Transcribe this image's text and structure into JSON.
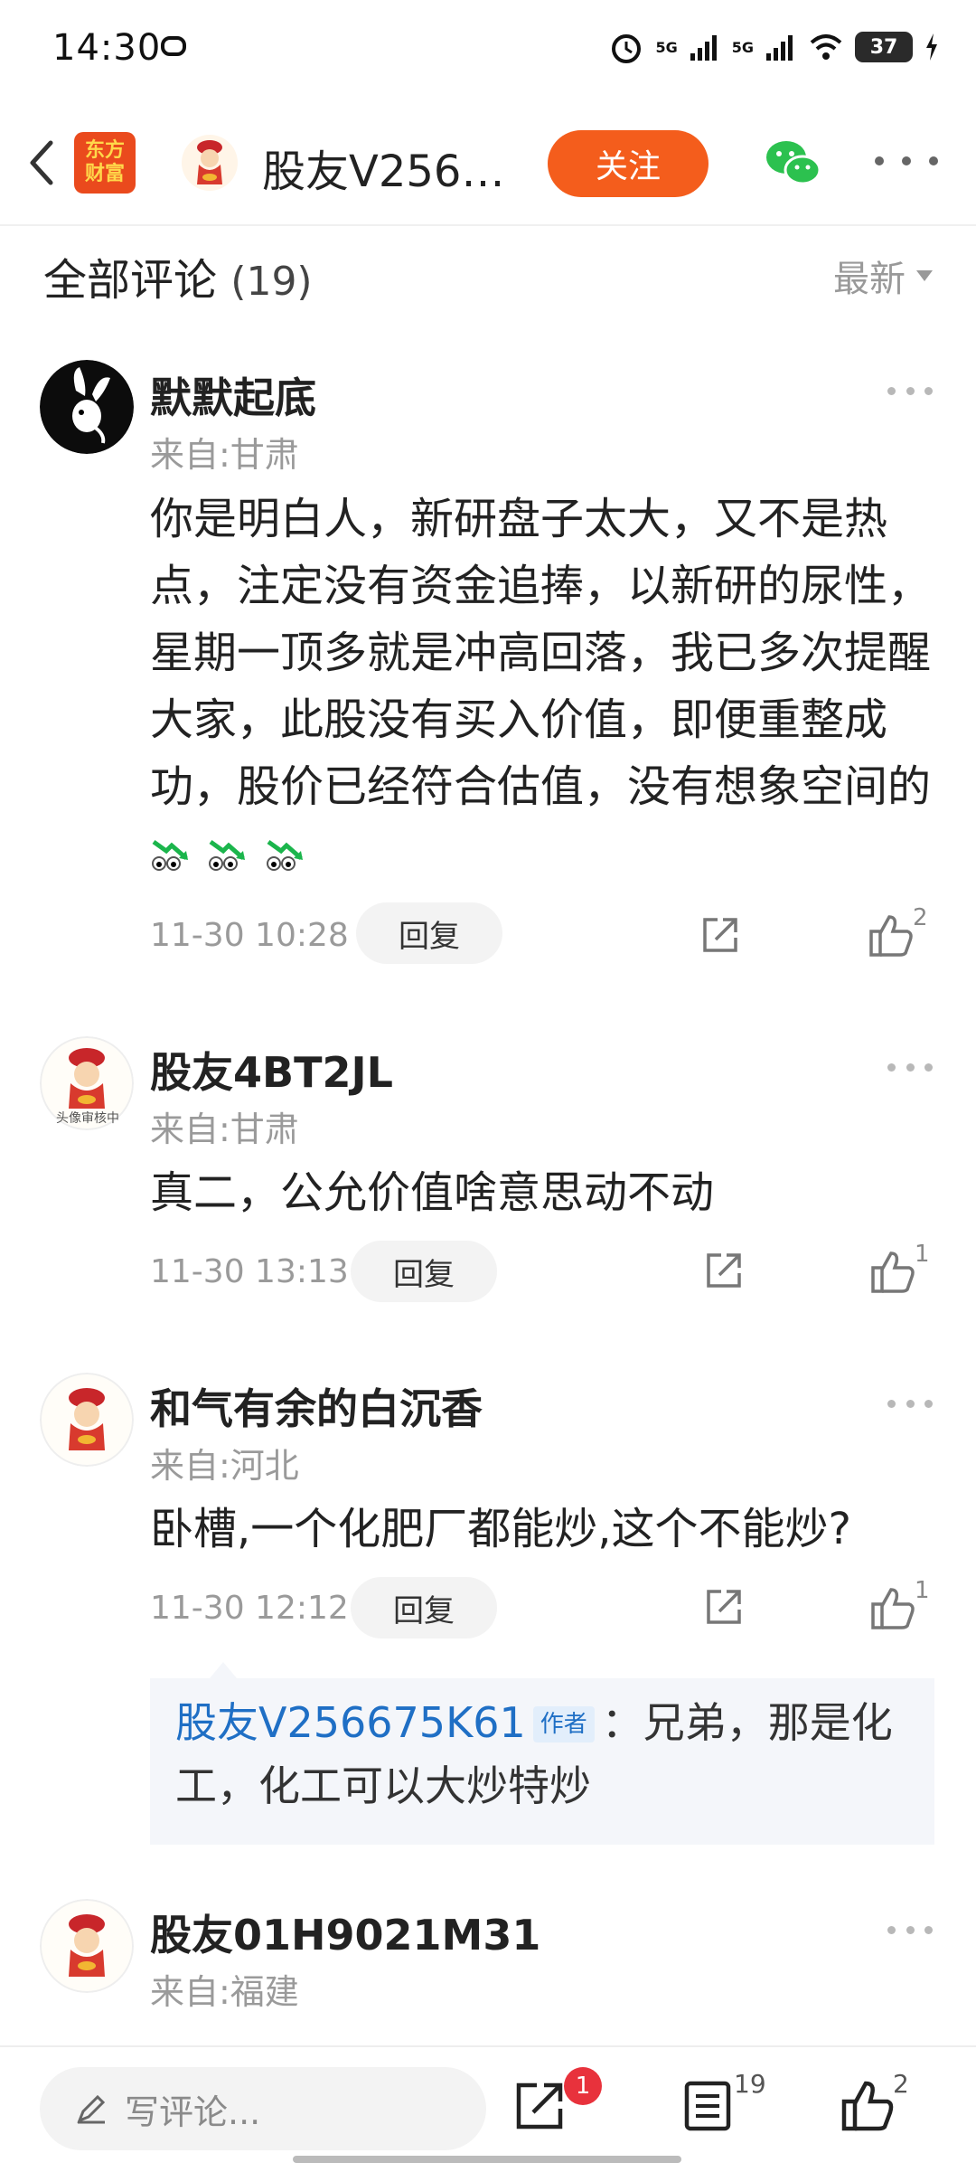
{
  "status_bar": {
    "time": "14:30",
    "network_1": "5G",
    "network_2": "5G",
    "battery": "37"
  },
  "header": {
    "logo_line1": "东方",
    "logo_line2": "财富",
    "title": "股友V256…",
    "follow_label": "关注"
  },
  "comments_section": {
    "title": "全部评论",
    "count": "(19)",
    "sort_label": "最新"
  },
  "comments": [
    {
      "username": "默默起底",
      "location": "来自:甘肃",
      "text": "你是明白人，新研盘子太大，又不是热点，注定没有资金追捧，以新研的尿性，星期一顶多就是冲高回落，我已多次提醒大家，此股没有买入价值，即便重整成功，股价已经符合估值，没有想象空间的",
      "time": "11-30 10:28",
      "reply_label": "回复",
      "likes": "2"
    },
    {
      "username": "股友4BT2JL",
      "location": "来自:甘肃",
      "text": "真二，公允价值啥意思动不动",
      "time": "11-30 13:13",
      "reply_label": "回复",
      "likes": "1",
      "avatar_caption": "头像审核中"
    },
    {
      "username": "和气有余的白沉香",
      "location": "来自:河北",
      "text": "卧槽,一个化肥厂都能炒,这个不能炒?",
      "time": "11-30 12:12",
      "reply_label": "回复",
      "likes": "1",
      "reply": {
        "author": "股友V256675K61",
        "badge": "作者",
        "text": "：兄弟，那是化工，化工可以大炒特炒"
      }
    },
    {
      "username": "股友01H9021M31",
      "location": "来自:福建"
    }
  ],
  "bottom_bar": {
    "placeholder": "写评论...",
    "share_badge": "1",
    "comment_count": "19",
    "like_count": "2"
  }
}
